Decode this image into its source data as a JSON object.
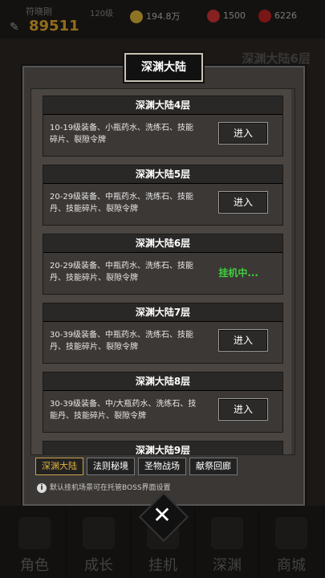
{
  "hud": {
    "hero_name": "符晓刚",
    "hero_level": "120级",
    "power": "89511",
    "gold": "194.8万",
    "gems": "1500",
    "tokens": "6226"
  },
  "background": {
    "map_title": "深渊大陆6层"
  },
  "modal": {
    "title": "深渊大陆",
    "floors": [
      {
        "name": "深渊大陆4层",
        "desc": "10-19级装备、小瓶药水、洗练石、技能碎片、裂隙令牌",
        "action": "进入"
      },
      {
        "name": "深渊大陆5层",
        "desc": "20-29级装备、中瓶药水、洗练石、技能丹、技能碎片、裂隙令牌",
        "action": "进入"
      },
      {
        "name": "深渊大陆6层",
        "desc": "20-29级装备、中瓶药水、洗练石、技能丹、技能碎片、裂隙令牌",
        "status": "挂机中..."
      },
      {
        "name": "深渊大陆7层",
        "desc": "30-39级装备、中瓶药水、洗练石、技能丹、技能碎片、裂隙令牌",
        "action": "进入"
      },
      {
        "name": "深渊大陆8层",
        "desc": "30-39级装备、中/大瓶药水、洗练石、技能丹、技能碎片、裂隙令牌",
        "action": "进入"
      },
      {
        "name": "深渊大陆9层"
      }
    ],
    "tabs": [
      "深渊大陆",
      "法则秘境",
      "圣物战场",
      "献祭回廊"
    ],
    "active_tab": 0,
    "note": "默认挂机场景可在托管BOSS界面设置"
  },
  "bottom_nav": [
    "角色",
    "成长",
    "挂机",
    "深渊",
    "商城"
  ],
  "colors": {
    "accent": "#e2b23c",
    "status_green": "#3fcf3f",
    "power": "#e2a72a"
  }
}
